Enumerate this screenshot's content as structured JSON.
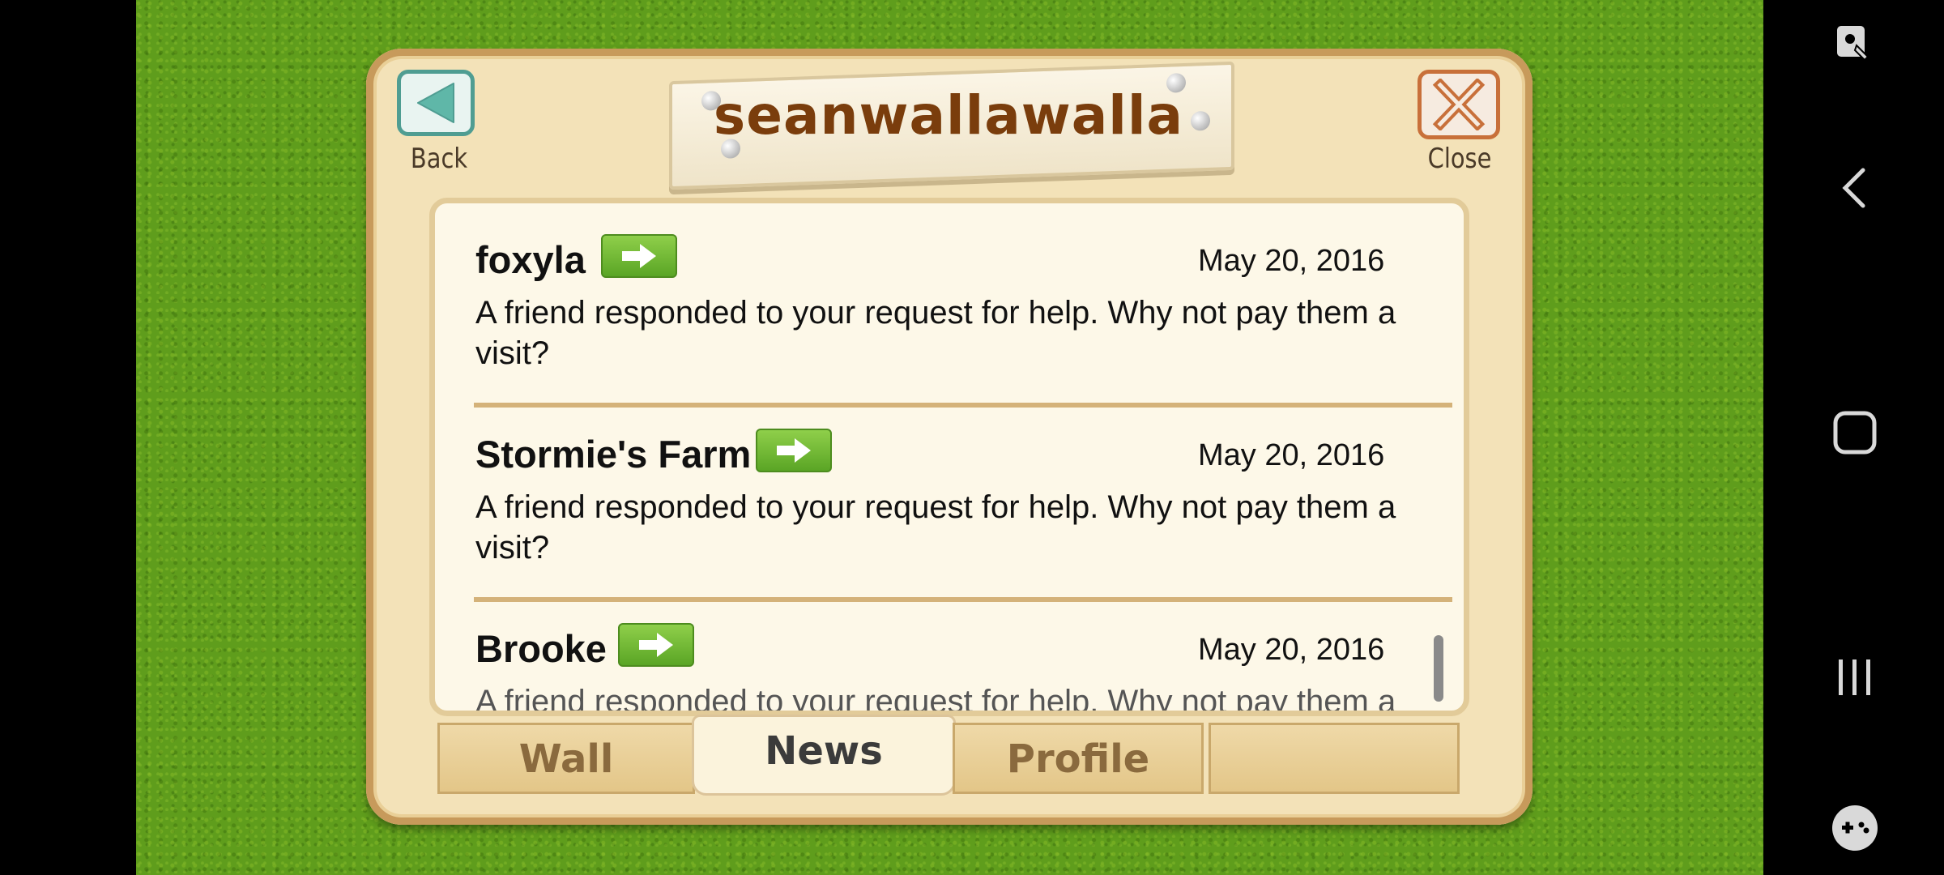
{
  "popup": {
    "title": "seanwallawalla",
    "back_label": "Back",
    "close_label": "Close"
  },
  "feed": [
    {
      "name": "foxyla",
      "date": "May 20, 2016",
      "message": "A friend responded to your request for help. Why not pay them a visit?"
    },
    {
      "name": "Stormie's Farm",
      "date": "May 20, 2016",
      "message": "A friend responded to your request for help. Why not pay them a visit?"
    },
    {
      "name": "Brooke",
      "date": "May 20, 2016",
      "message": "A friend responded to your request for help. Why not pay them a visit?"
    }
  ],
  "tabs": [
    {
      "label": "Wall",
      "active": false
    },
    {
      "label": "News",
      "active": true
    },
    {
      "label": "Profile",
      "active": false
    },
    {
      "label": "",
      "active": false
    }
  ],
  "nav": {
    "icons": [
      "screen-pin-icon",
      "back-arrow-icon",
      "home-icon",
      "recent-apps-icon",
      "game-launcher-icon"
    ]
  },
  "colors": {
    "grass": "#5f9d1c",
    "title_text": "#7a3d0c",
    "visit_button": "#6db42e",
    "back_button": "#4f9d92",
    "close_button": "#c8703a"
  }
}
